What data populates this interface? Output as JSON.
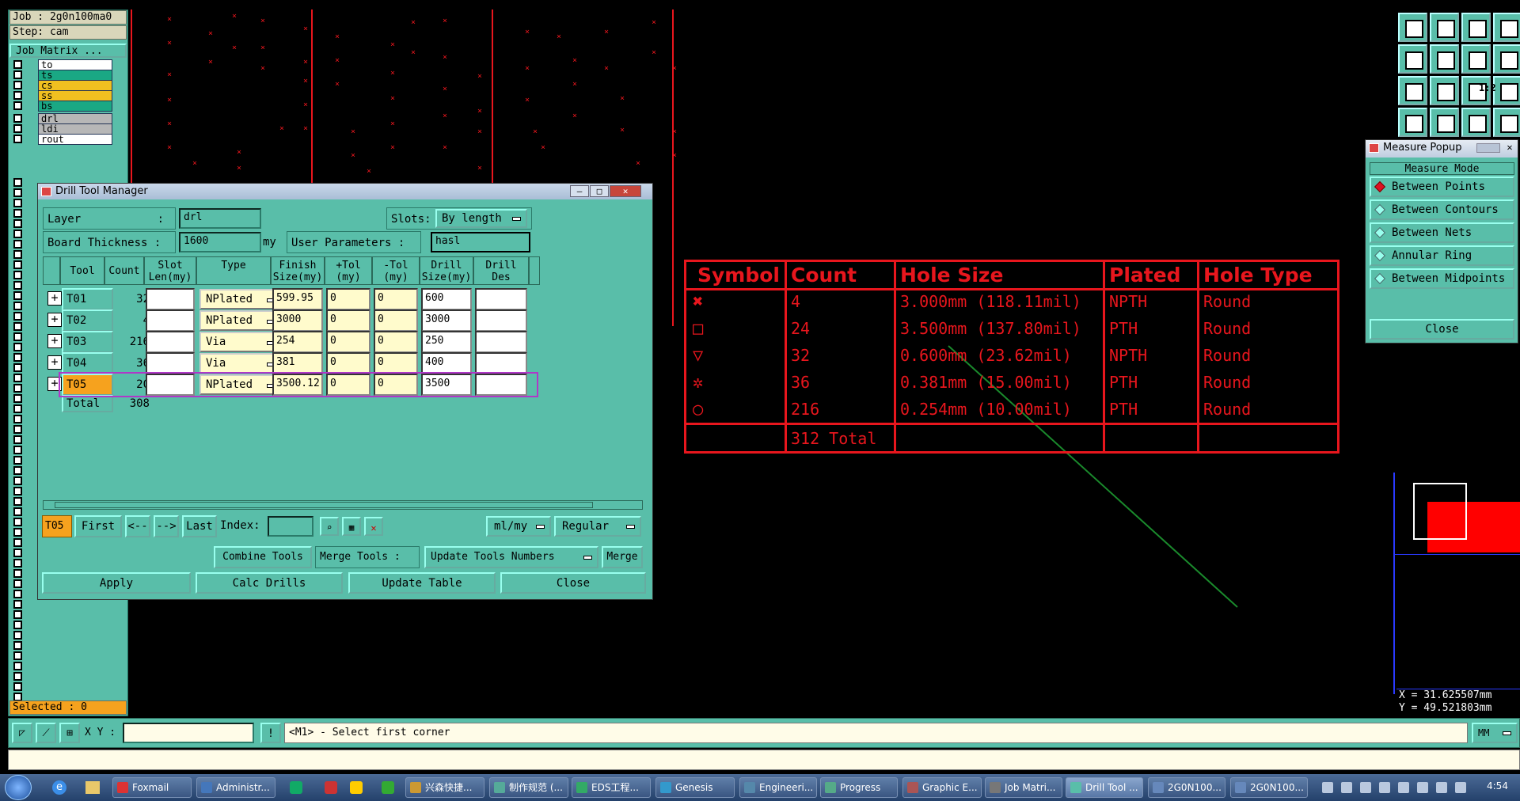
{
  "left_panel": {
    "job": "Job : 2g0n100ma0",
    "step": "Step: cam",
    "job_matrix_button": "Job Matrix ...",
    "layers": [
      {
        "name": "to",
        "color": "#ffffff"
      },
      {
        "name": "ts",
        "color": "#1aa884"
      },
      {
        "name": "cs",
        "color": "#f0c020"
      },
      {
        "name": "ss",
        "color": "#f0c020"
      },
      {
        "name": "bs",
        "color": "#1aa884"
      },
      {
        "name": "drl",
        "color": "#b7b7b7"
      },
      {
        "name": "ldi",
        "color": "#b7b7b7"
      },
      {
        "name": "rout",
        "color": "#ffffff"
      }
    ],
    "selected": "Selected : 0"
  },
  "dtm": {
    "title": "Drill Tool Manager",
    "layer_label": "Layer",
    "layer_colon": ":",
    "layer_value": "drl",
    "slots_label": "Slots:",
    "slots_value": "By length",
    "board_thickness_label": "Board Thickness :",
    "board_thickness_value": "1600",
    "unit_my": "my",
    "user_params_label": "User Parameters :",
    "user_params_value": "hasl",
    "columns": [
      "Tool",
      "Count",
      "Slot\nLen(my)",
      "Type",
      "Finish\nSize(my)",
      "+Tol\n(my)",
      "-Tol\n(my)",
      "Drill\nSize(my)",
      "Drill\nDes"
    ],
    "rows": [
      {
        "tool": "T01",
        "count": "32",
        "type": "NPlated",
        "finish": "599.95",
        "ptol": "0",
        "mtol": "0",
        "drill": "600",
        "plus": "+"
      },
      {
        "tool": "T02",
        "count": "4",
        "type": "NPlated",
        "finish": "3000",
        "ptol": "0",
        "mtol": "0",
        "drill": "3000",
        "plus": "+"
      },
      {
        "tool": "T03",
        "count": "216",
        "type": "Via",
        "finish": "254",
        "ptol": "0",
        "mtol": "0",
        "drill": "250",
        "plus": "+"
      },
      {
        "tool": "T04",
        "count": "36",
        "type": "Via",
        "finish": "381",
        "ptol": "0",
        "mtol": "0",
        "drill": "400",
        "plus": "+"
      },
      {
        "tool": "T05",
        "count": "20",
        "type": "NPlated",
        "finish": "3500.12",
        "ptol": "0",
        "mtol": "0",
        "drill": "3500",
        "plus": "+"
      }
    ],
    "total_label": "Total",
    "total_count": "308",
    "current_tool": "T05",
    "nav": {
      "first": "First",
      "prev": "<--",
      "next": "-->",
      "last": "Last",
      "index": "Index:"
    },
    "units_select": "ml/my",
    "mode_select": "Regular",
    "combine_tools": "Combine Tools",
    "merge_tools": "Merge Tools :",
    "update_tools_numbers": "Update Tools Numbers",
    "merge": "Merge",
    "apply": "Apply",
    "calc_drills": "Calc Drills",
    "update_table": "Update Table",
    "close": "Close"
  },
  "drill_table": {
    "headers": [
      "Symbol",
      "Count",
      "Hole Size",
      "Plated",
      "Hole Type"
    ],
    "rows": [
      {
        "symbol": "star-cross",
        "count": "4",
        "size": "3.000mm (118.11mil)",
        "plated": "NPTH",
        "type": "Round"
      },
      {
        "symbol": "square",
        "count": "24",
        "size": "3.500mm (137.80mil)",
        "plated": "PTH",
        "type": "Round"
      },
      {
        "symbol": "triangle",
        "count": "32",
        "size": "0.600mm (23.62mil)",
        "plated": "NPTH",
        "type": "Round"
      },
      {
        "symbol": "gear",
        "count": "36",
        "size": "0.381mm (15.00mil)",
        "plated": "PTH",
        "type": "Round"
      },
      {
        "symbol": "circle",
        "count": "216",
        "size": "0.254mm (10.00mil)",
        "plated": "PTH",
        "type": "Round"
      }
    ],
    "total": "312 Total",
    "line_color": "#e8161d"
  },
  "measure_popup": {
    "title": "Measure Popup",
    "mode_label": "Measure Mode",
    "options": [
      "Between Points",
      "Between Contours",
      "Between Nets",
      "Annular Ring",
      "Between Midpoints"
    ],
    "selected": "Between Points",
    "close": "Close"
  },
  "right_toolbar": {
    "ratio_label": "1:2"
  },
  "coords": {
    "x": "X = 31.625507mm",
    "y": "Y = 49.521803mm"
  },
  "status": {
    "xy_label": "X Y :",
    "message": "<M1> - Select first corner",
    "unit": "MM"
  },
  "taskbar": {
    "items": [
      "Foxmail",
      "Administr...",
      "兴森快捷...",
      "制作规范 (...",
      "EDS工程...",
      "Genesis",
      "Engineeri...",
      "Progress",
      "Graphic E...",
      "Job Matri...",
      "Drill Tool ...",
      "2G0N100...",
      "2G0N100..."
    ],
    "active": "Drill Tool ...",
    "clock": "4:54"
  }
}
